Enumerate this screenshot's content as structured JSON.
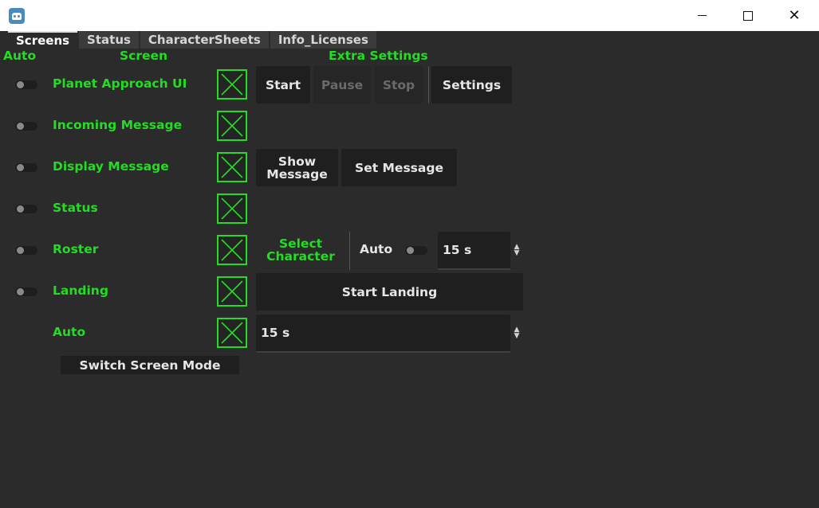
{
  "window": {
    "close_glyph": "✕"
  },
  "tabs": [
    {
      "label": "Screens",
      "active": true
    },
    {
      "label": "Status",
      "active": false
    },
    {
      "label": "CharacterSheets",
      "active": false
    },
    {
      "label": "Info_Licenses",
      "active": false
    }
  ],
  "headers": {
    "auto": "Auto",
    "screen": "Screen",
    "extra": "Extra Settings"
  },
  "rows": [
    {
      "label": "Planet Approach UI",
      "auto_on": false,
      "checked": true
    },
    {
      "label": "Incoming Message",
      "auto_on": false,
      "checked": true
    },
    {
      "label": "Display Message",
      "auto_on": false,
      "checked": true
    },
    {
      "label": "Status",
      "auto_on": false,
      "checked": true
    },
    {
      "label": "Roster",
      "auto_on": false,
      "checked": true
    },
    {
      "label": "Landing",
      "auto_on": false,
      "checked": true
    },
    {
      "label": "Auto",
      "checked": true
    }
  ],
  "planet": {
    "start": "Start",
    "pause": "Pause",
    "stop": "Stop",
    "settings": "Settings"
  },
  "display": {
    "show_line1": "Show",
    "show_line2": "Message",
    "set": "Set Message"
  },
  "roster": {
    "select_line1": "Select",
    "select_line2": "Character",
    "auto_label": "Auto",
    "interval": "15 s"
  },
  "landing": {
    "start": "Start Landing"
  },
  "auto_row": {
    "interval": "15 s"
  },
  "mode_button": "Switch Screen Mode",
  "colors": {
    "accent": "#22dd22",
    "background": "#2b2b2b"
  }
}
